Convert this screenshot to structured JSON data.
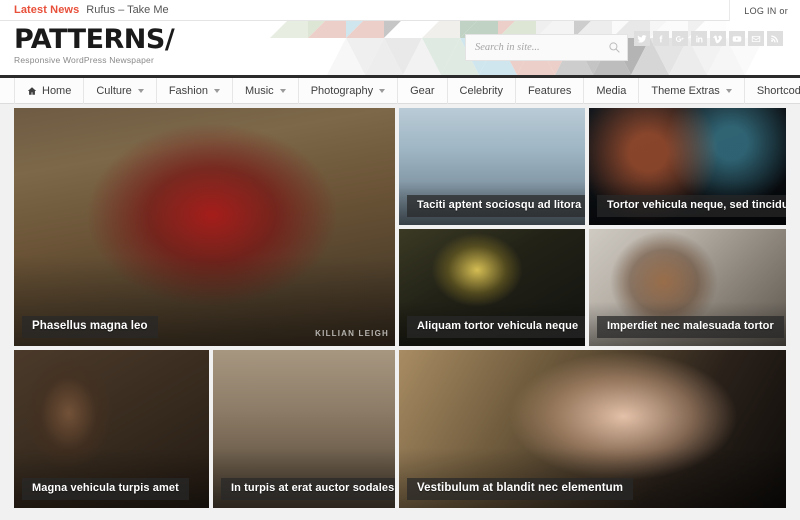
{
  "topbar": {
    "latest_label": "Latest News",
    "latest_item": "Rufus – Take Me",
    "login_text": "LOG IN or"
  },
  "brand": {
    "title": "PATTERNS/",
    "tagline": "Responsive WordPress Newspaper"
  },
  "search": {
    "placeholder": "Search in site...",
    "value": "",
    "icon": "search-icon"
  },
  "socials": [
    {
      "name": "twitter",
      "icon": "twitter-icon"
    },
    {
      "name": "facebook",
      "icon": "facebook-icon"
    },
    {
      "name": "google-plus",
      "icon": "google-plus-icon"
    },
    {
      "name": "linkedin",
      "icon": "linkedin-icon"
    },
    {
      "name": "vimeo",
      "icon": "vimeo-icon"
    },
    {
      "name": "youtube",
      "icon": "youtube-icon"
    },
    {
      "name": "email",
      "icon": "envelope-icon"
    },
    {
      "name": "rss",
      "icon": "rss-icon"
    }
  ],
  "nav": [
    {
      "label": "Home",
      "icon": "home-icon",
      "dropdown": false
    },
    {
      "label": "Culture",
      "dropdown": true
    },
    {
      "label": "Fashion",
      "dropdown": true
    },
    {
      "label": "Music",
      "dropdown": true
    },
    {
      "label": "Photography",
      "dropdown": true
    },
    {
      "label": "Gear",
      "dropdown": false
    },
    {
      "label": "Celebrity",
      "dropdown": false
    },
    {
      "label": "Features",
      "dropdown": false
    },
    {
      "label": "Media",
      "dropdown": false
    },
    {
      "label": "Theme Extras",
      "dropdown": true
    },
    {
      "label": "Shortcodes",
      "dropdown": false
    }
  ],
  "featured": [
    {
      "title": "Phasellus magna leo",
      "watermark": "KILLIAN LEIGH"
    },
    {
      "title": "Taciti aptent sociosqu ad litora"
    },
    {
      "title": "Tortor vehicula neque, sed tincidunt"
    },
    {
      "title": "Aliquam tortor vehicula neque"
    },
    {
      "title": "Imperdiet nec malesuada tortor"
    },
    {
      "title": "Magna vehicula turpis amet"
    },
    {
      "title": "In turpis at erat auctor sodales"
    },
    {
      "title": "Vestibulum at blandit nec elementum"
    }
  ],
  "colors": {
    "accent": "#e8503a",
    "nav_bar_top": "#2b2b2b",
    "social_tile": "#dedede",
    "caption_bg": "rgba(40,40,40,.72)",
    "pattern_green": "#dde6d4",
    "pattern_blue": "#cfe6ee",
    "pattern_gray": "#c6c6c6",
    "pattern_pink": "#eccfc8",
    "pattern_sage": "#bfd2c3",
    "pattern_cream": "#f1f0ec"
  }
}
